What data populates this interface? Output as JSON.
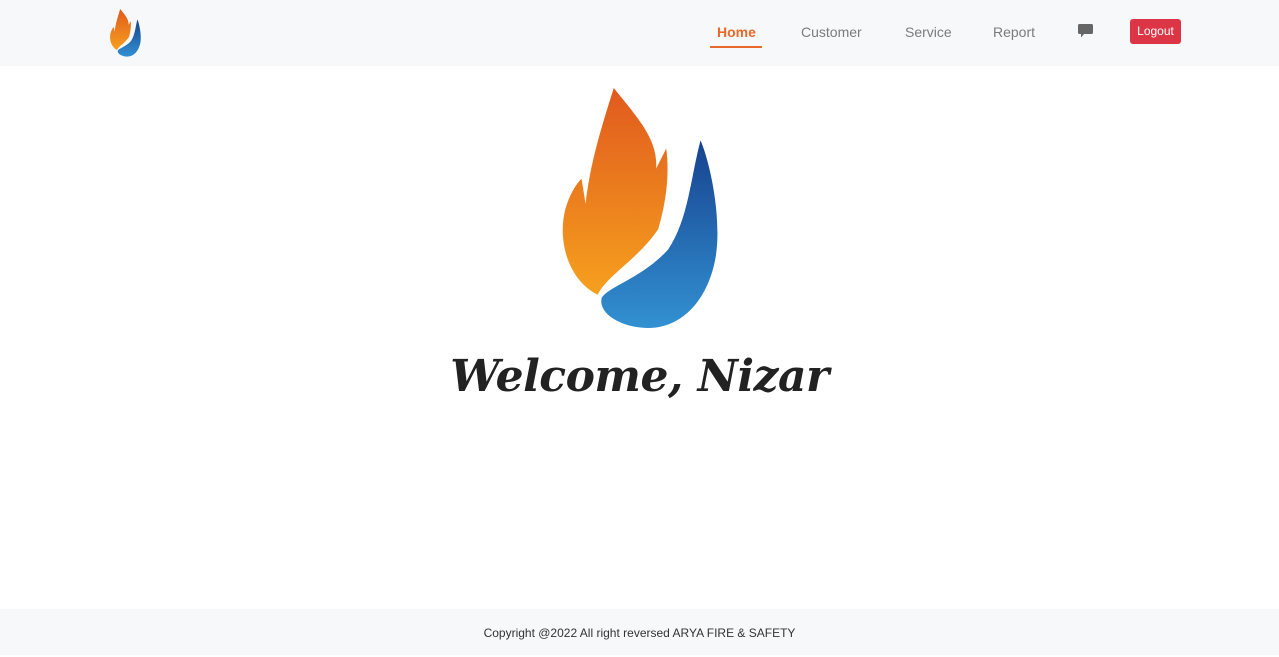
{
  "nav": {
    "items": [
      {
        "label": "Home",
        "active": true
      },
      {
        "label": "Customer",
        "active": false
      },
      {
        "label": "Service",
        "active": false
      },
      {
        "label": "Report",
        "active": false
      }
    ],
    "chat_icon": "chat-bubble-icon",
    "logout_label": "Logout"
  },
  "hero": {
    "welcome": "Welcome, Nizar"
  },
  "footer": {
    "copyright": "Copyright @2022 All right reversed ARYA FIRE & SAFETY"
  },
  "colors": {
    "accent": "#e8692a",
    "logout": "#dc3545",
    "flame_orange": "#f39a1e",
    "flame_blue": "#2c7fc4",
    "navbar_bg": "#f7f8fa"
  }
}
